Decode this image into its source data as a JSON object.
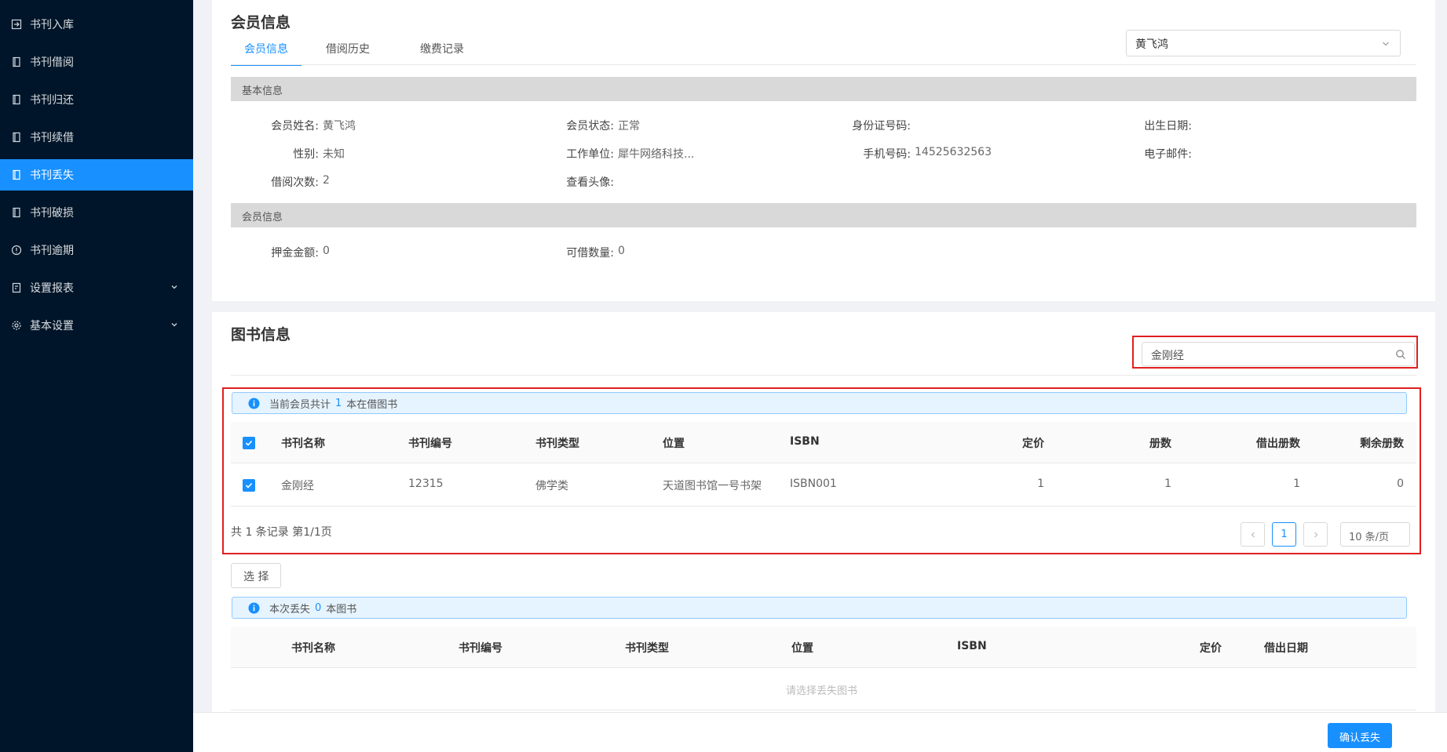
{
  "sidebar": {
    "items": [
      {
        "label": "书刊入库",
        "icon": "login-icon",
        "active": false
      },
      {
        "label": "书刊借阅",
        "icon": "book-icon",
        "active": false
      },
      {
        "label": "书刊归还",
        "icon": "book-icon",
        "active": false
      },
      {
        "label": "书刊续借",
        "icon": "book-icon",
        "active": false
      },
      {
        "label": "书刊丢失",
        "icon": "book-icon",
        "active": true
      },
      {
        "label": "书刊破损",
        "icon": "book-icon",
        "active": false
      },
      {
        "label": "书刊逾期",
        "icon": "info-circle-icon",
        "active": false
      },
      {
        "label": "设置报表",
        "icon": "report-icon",
        "active": false,
        "expandable": true
      },
      {
        "label": "基本设置",
        "icon": "gear-icon",
        "active": false,
        "expandable": true
      }
    ]
  },
  "member": {
    "title": "会员信息",
    "tabs": [
      "会员信息",
      "借阅历史",
      "缴费记录"
    ],
    "selected_member": "黄飞鸿",
    "basic_title": "基本信息",
    "fields": {
      "name_label": "会员姓名:",
      "name": "黄飞鸿",
      "status_label": "会员状态:",
      "status": "正常",
      "idcard_label": "身份证号码:",
      "idcard": "",
      "birth_label": "出生日期:",
      "birth": "",
      "gender_label": "性别:",
      "gender": "未知",
      "work_label": "工作单位:",
      "work": "犀牛网络科技...",
      "phone_label": "手机号码:",
      "phone": "14525632563",
      "email_label": "电子邮件:",
      "email": "",
      "borrow_count_label": "借阅次数:",
      "borrow_count": "2",
      "avatar_label": "查看头像:"
    },
    "member_info_title": "会员信息",
    "deposit_label": "押金金额:",
    "deposit": "0",
    "borrowable_label": "可借数量:",
    "borrowable": "0"
  },
  "books": {
    "title": "图书信息",
    "search_value": "金刚经",
    "alert_prefix": "当前会员共计",
    "alert_count": "1",
    "alert_suffix": "本在借图书",
    "columns": [
      "书刊名称",
      "书刊编号",
      "书刊类型",
      "位置",
      "ISBN",
      "定价",
      "册数",
      "借出册数",
      "剩余册数"
    ],
    "rows": [
      [
        "金刚经",
        "12315",
        "佛学类",
        "天道图书馆一号书架",
        "ISBN001",
        "1",
        "1",
        "1",
        "0"
      ]
    ],
    "summary": "共 1 条记录 第1/1页",
    "page": "1",
    "page_size": "10 条/页"
  },
  "lost": {
    "select_button": "选 择",
    "alert_prefix": "本次丢失",
    "alert_count": "0",
    "alert_suffix": "本图书",
    "columns": [
      "书刊名称",
      "书刊编号",
      "书刊类型",
      "位置",
      "ISBN",
      "定价",
      "借出日期"
    ],
    "empty_text": "请选择丢失图书"
  },
  "footer": {
    "confirm_button": "确认丢失"
  },
  "colors": {
    "primary": "#1890ff",
    "sidebar_bg": "#001529",
    "highlight": "#e02020"
  }
}
